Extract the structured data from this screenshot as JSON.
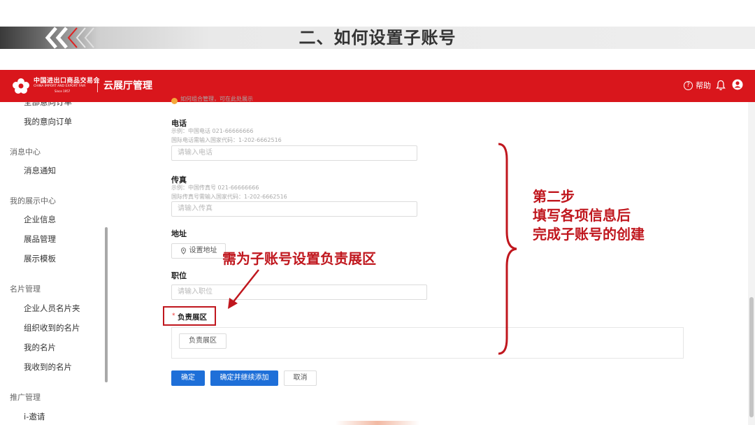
{
  "slide": {
    "title": "二、如何设置子账号"
  },
  "header": {
    "logo_text_cn": "中国进出口商品交易会",
    "logo_text_en": "CHINA IMPORT AND EXPORT FAIR",
    "logo_text_since": "Since 1957",
    "app_title": "云展厅管理",
    "help_label": "帮助",
    "brand_color": "#d9161c"
  },
  "sidebar": {
    "top_cut_item": "全部意向订单",
    "groups": [
      {
        "title": "",
        "items": [
          "我的意向订单"
        ]
      },
      {
        "title": "消息中心",
        "items": [
          "消息通知"
        ]
      },
      {
        "title": "我的展示中心",
        "items": [
          "企业信息",
          "展品管理",
          "展示模板"
        ]
      },
      {
        "title": "名片管理",
        "items": [
          "企业人员名片夹",
          "组织收到的名片",
          "我的名片",
          "我收到的名片"
        ]
      },
      {
        "title": "推广管理",
        "items": [
          "i-邀请"
        ]
      }
    ]
  },
  "form": {
    "tip": "如何组合管理，可在此处展示",
    "phone": {
      "label": "电话",
      "hint1": "示例：中国电话 021-66666666",
      "hint2": "国际电话需输入国家代码：1-202-6662516",
      "placeholder": "请输入电话"
    },
    "fax": {
      "label": "传真",
      "hint1": "示例：中国传真号 021-66666666",
      "hint2": "国际传真号需输入国家代码：1-202-6662516",
      "placeholder": "请输入传真"
    },
    "address": {
      "label": "地址",
      "button": "设置地址"
    },
    "position": {
      "label": "职位",
      "placeholder": "请输入职位"
    },
    "area": {
      "required_mark": "*",
      "label": "负责展区",
      "button": "负责展区"
    },
    "buttons": {
      "confirm": "确定",
      "confirm_continue": "确定并继续添加",
      "cancel": "取消"
    }
  },
  "annotations": {
    "callout": "需为子账号设置负责展区",
    "step_line1": "第二步",
    "step_line2": "填写各项信息后",
    "step_line3": "完成子账号的创建",
    "color": "#c0171e"
  },
  "icons": [
    "logo-icon",
    "help-icon",
    "bell-icon",
    "user-icon",
    "location-icon"
  ]
}
